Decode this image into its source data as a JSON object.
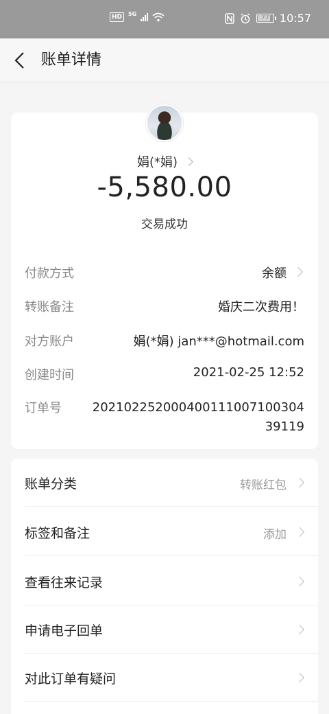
{
  "status_bar": {
    "hd": "HD",
    "network": "5G",
    "battery": "77",
    "battery_level": 0.77,
    "time": "10:57"
  },
  "header": {
    "title": "账单详情"
  },
  "summary": {
    "payee": "娟(*娟)",
    "amount": "-5,580.00",
    "status": "交易成功"
  },
  "details": [
    {
      "label": "付款方式",
      "value": "余额",
      "chevron": true
    },
    {
      "label": "转账备注",
      "value": "婚庆二次费用！",
      "chevron": false
    },
    {
      "label": "对方账户",
      "value": "娟(*娟) jan***@hotmail.com",
      "chevron": false
    },
    {
      "label": "创建时间",
      "value": "2021-02-25 12:52",
      "chevron": false
    },
    {
      "label": "订单号",
      "value": "20210225200040011100710030439119",
      "chevron": false
    }
  ],
  "menu": [
    {
      "label": "账单分类",
      "value": "转账红包"
    },
    {
      "label": "标签和备注",
      "value": "添加"
    },
    {
      "label": "查看往来记录",
      "value": ""
    },
    {
      "label": "申请电子回单",
      "value": ""
    },
    {
      "label": "对此订单有疑问",
      "value": ""
    }
  ]
}
